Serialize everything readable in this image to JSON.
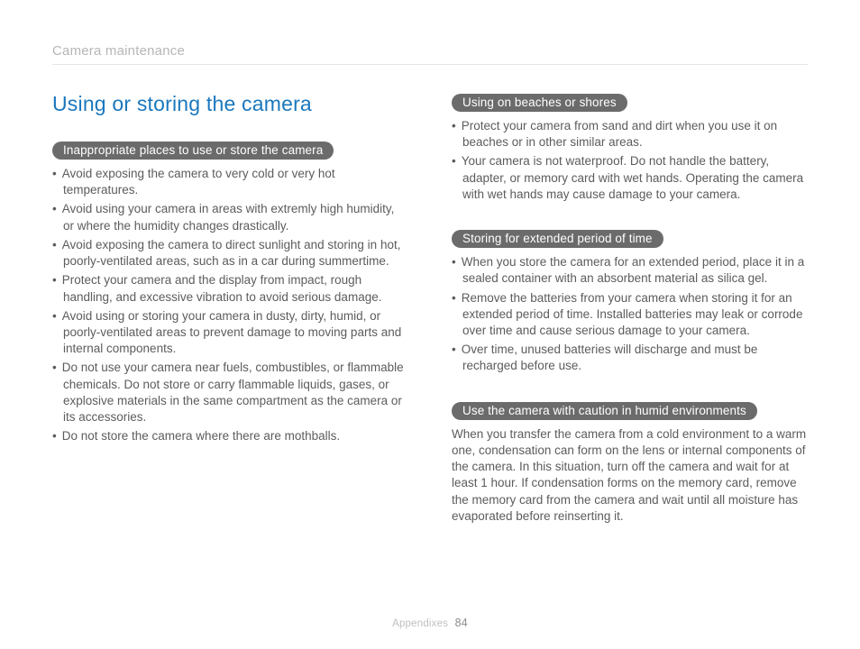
{
  "runningHead": "Camera maintenance",
  "mainHeading": "Using or storing the camera",
  "left": {
    "sec1": {
      "pill": "Inappropriate places to use or store the camera",
      "items": [
        "Avoid exposing the camera to very cold or very hot temperatures.",
        "Avoid using your camera in areas with extremly high humidity, or where the humidity changes drastically.",
        "Avoid exposing the camera to direct sunlight and storing in hot, poorly-ventilated areas, such as in a car during summertime.",
        "Protect your camera and the display from impact, rough handling, and excessive vibration to avoid serious damage.",
        "Avoid using or storing your camera in dusty, dirty, humid, or poorly-ventilated areas to prevent damage to moving parts and internal components.",
        "Do not use your camera near fuels, combustibles, or flammable chemicals. Do not store or carry flammable liquids, gases, or explosive materials in the same compartment as the camera or its accessories.",
        "Do not store the camera where there are mothballs."
      ]
    }
  },
  "right": {
    "sec1": {
      "pill": "Using on beaches or shores",
      "items": [
        "Protect your camera from sand and dirt when you use it on beaches or in other similar areas.",
        "Your camera is not waterproof. Do not handle the battery, adapter, or memory card with wet hands. Operating the camera with wet hands may cause damage to your camera."
      ]
    },
    "sec2": {
      "pill": "Storing for extended period of time",
      "items": [
        "When you store the camera for an extended period, place it in a sealed container with an absorbent material as silica gel.",
        "Remove the batteries from your camera when storing it for an extended period of time. Installed batteries may leak or corrode over time and cause serious damage to your camera.",
        "Over time, unused batteries will discharge and must be recharged before use."
      ]
    },
    "sec3": {
      "pill": "Use the camera with caution in humid environments",
      "para": "When you transfer the camera from a cold environment to a warm one, condensation can form on the lens or internal components of the camera. In this situation, turn off the camera and wait for at least 1 hour. If condensation forms on the memory card, remove the memory card from the camera and wait until all moisture has evaporated before reinserting it."
    }
  },
  "footer": {
    "section": "Appendixes",
    "page": "84"
  }
}
